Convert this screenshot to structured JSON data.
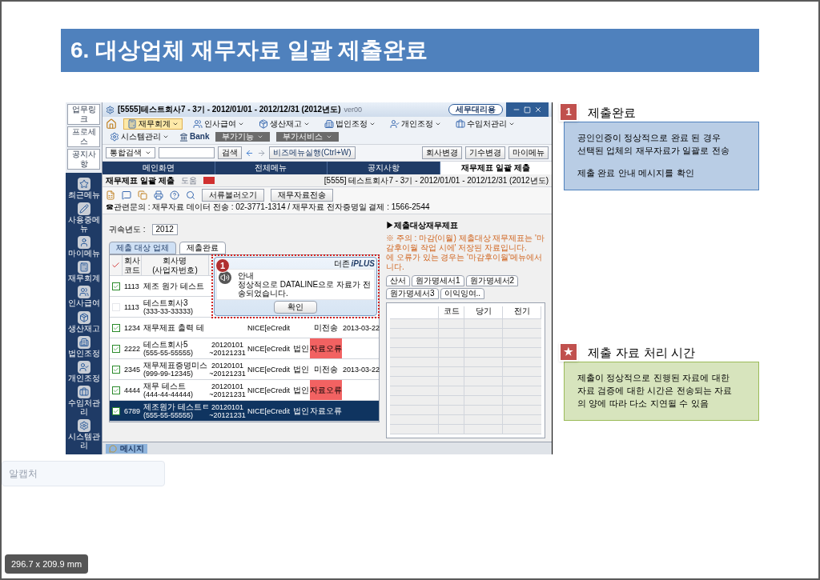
{
  "page": {
    "title": "6. 대상업체 재무자료 일괄 제출완료",
    "paper_size": "296.7 x 209.9 mm",
    "overlay_label": "알캡처"
  },
  "app": {
    "quick_buttons": [
      "업무링크",
      "프로세스",
      "공지사항"
    ],
    "side_menu": [
      "최근메뉴",
      "사용중메뉴",
      "마이메뉴",
      "재무회계",
      "인사급여",
      "생산재고",
      "법인조정",
      "개인조정",
      "수임처관리",
      "시스템관리"
    ],
    "window_title": "[5555]테스트회사7 - 3기 - 2012/01/01 - 2012/12/31 (2012년도)",
    "version": "ver00",
    "title_button": "세무대리용",
    "menu": [
      {
        "label": "재무회계",
        "selected": true
      },
      {
        "label": "인사급여",
        "selected": false
      },
      {
        "label": "생산재고",
        "selected": false
      },
      {
        "label": "법인조정",
        "selected": false
      },
      {
        "label": "개인조정",
        "selected": false
      },
      {
        "label": "수임처관리",
        "selected": false
      },
      {
        "label": "시스템관리",
        "selected": false
      }
    ],
    "bank": "Bank",
    "extra_buttons": [
      "부가기능",
      "부가서비스"
    ],
    "search": {
      "value": "통합검색",
      "button": "검색"
    },
    "shortcut": "비즈메뉴실행(Ctrl+W)",
    "account_buttons": [
      "회사변경",
      "기수변경",
      "마이메뉴"
    ],
    "tabs": [
      {
        "label": "메인화면",
        "selected": false
      },
      {
        "label": "전체메뉴",
        "selected": false
      },
      {
        "label": "공지사항",
        "selected": false
      },
      {
        "label": "재무제표 일괄 제출",
        "selected": true
      }
    ],
    "screen": {
      "title": "재무제표 일괄 제출",
      "help": "도움",
      "company_info": "[5555] 테스트회사7 - 3기 - 2012/01/01 - 2012/12/31 (2012년도)"
    },
    "actions": [
      "서류불러오기",
      "재무자료전송"
    ],
    "contact": "☎관련문의 : 재무자료 데이터 전송 : 02-3771-1314 / 재무자료 전자증명일 결제 : 1566-2544",
    "year": {
      "label": "귀속년도 :",
      "value": "2012"
    },
    "subtabs": [
      {
        "label": "제출 대상 업체",
        "selected": true
      },
      {
        "label": "제출완료",
        "selected": false
      }
    ],
    "table": {
      "columns": [
        "회사\n코드",
        "회사명\n(사업자번호)"
      ],
      "rows": [
        {
          "checked": true,
          "selected": false,
          "code": "1113",
          "name": "제조 원가 테스트"
        },
        {
          "checked": false,
          "selected": false,
          "code": "1113",
          "name": "테스트회사3",
          "bizno": "(333-33-33333)"
        },
        {
          "checked": true,
          "selected": false,
          "code": "1234",
          "name": "재무제표 출력 테",
          "agency": "NICE[eCredit",
          "status": "미전송",
          "error": false,
          "date": "2013-03-22"
        },
        {
          "checked": true,
          "selected": false,
          "code": "2222",
          "name": "테스트회사5",
          "bizno": "(555-55-55555)",
          "period_from": "20120101",
          "period_to": "~20121231",
          "agency": "NICE[eCredit",
          "type": "법인",
          "status": "자료오류",
          "error": true
        },
        {
          "checked": true,
          "selected": false,
          "code": "2345",
          "name": "재무제표증명미스",
          "bizno": "(999-99-12345)",
          "period_from": "20120101",
          "period_to": "~20121231",
          "agency": "NICE[eCredit",
          "type": "법인",
          "status": "미전송",
          "error": false,
          "date": "2013-03-22"
        },
        {
          "checked": true,
          "selected": false,
          "code": "4444",
          "name": "재무 테스트",
          "bizno": "(444-44-44444)",
          "period_from": "20120101",
          "period_to": "~20121231",
          "agency": "NICE[eCredit",
          "type": "법인",
          "status": "자료오류",
          "error": true
        },
        {
          "checked": true,
          "selected": true,
          "code": "6789",
          "name": "제조원가 테스트ㅌ",
          "bizno": "(555-55-55555)",
          "period_from": "20120101",
          "period_to": "~20121231",
          "agency": "NICE[eCredit",
          "type": "법인",
          "status": "자료오류",
          "error": false
        }
      ]
    },
    "statements": {
      "heading": "▶제출대상재무제표",
      "notice": [
        "※ 주의 : 마감(이월) 제출대상 재무제표는 '마감후이월 작업 시에' 저장된 자료입니다.",
        "에 오류가 있는 경우는 '마감후이월'메뉴에서",
        "니다."
      ],
      "tabs": [
        {
          "label": "산서",
          "selected": false
        },
        {
          "label": "원가명세서1",
          "selected": false
        },
        {
          "label": "원가명세서2",
          "selected": false
        },
        {
          "label": "원가명세서3",
          "selected": false
        },
        {
          "label": "이익잉여..",
          "selected": false
        }
      ],
      "columns": [
        "코드",
        "당기",
        "전기"
      ]
    },
    "dialog": {
      "marker": "1",
      "brand": "더존",
      "product": "iPLUS",
      "title": "안내",
      "message": "정상적으로 DATALINE으로 자료가 전송되었습니다.",
      "button": "확인"
    },
    "status_bar": {
      "label": "메시지"
    }
  },
  "notes": [
    {
      "kind": "info",
      "badge": "1",
      "title": "제출완료",
      "paragraphs": [
        "공인인증이 정상적으로 완료 된 경우\n선택된 업체의 재무자료가 일괄로 전송",
        "제출 완료 안내 메시지를 확인"
      ]
    },
    {
      "kind": "tip",
      "badge": "★",
      "title": "제출 자료 처리 시간",
      "paragraphs": [
        "제출이 정상적으로 진행된 자료에 대한\n자료 검증에 대한 시간은 전송되는 자료\n의 양에 따라 다소 지연될 수 있음"
      ]
    }
  ]
}
